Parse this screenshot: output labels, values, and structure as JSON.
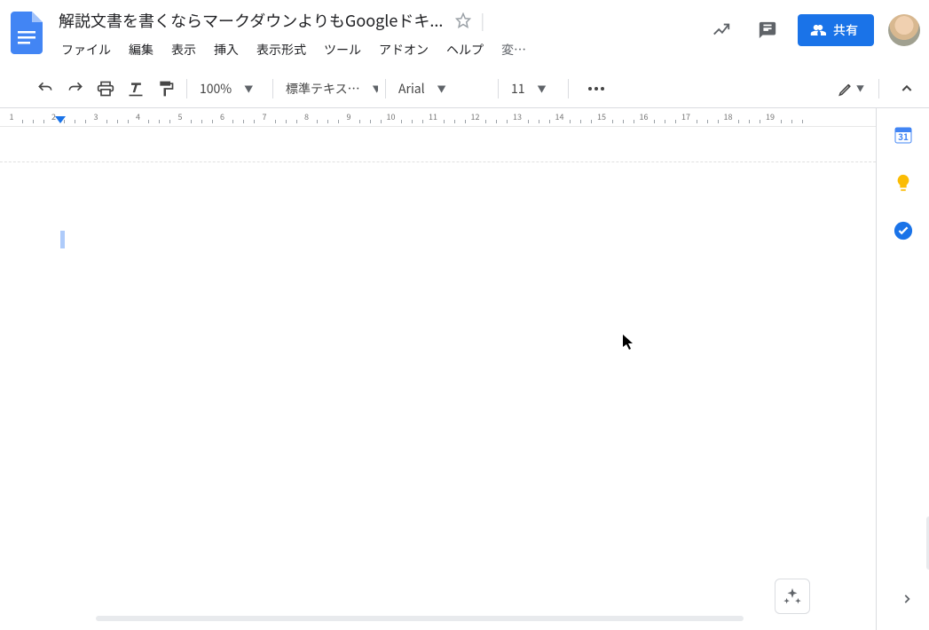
{
  "header": {
    "title": "解説文書を書くならマークダウンよりもGoogleドキ...",
    "menus": [
      "ファイル",
      "編集",
      "表示",
      "挿入",
      "表示形式",
      "ツール",
      "アドオン",
      "ヘルプ"
    ],
    "last_edit": "変…",
    "share_label": "共有"
  },
  "toolbar": {
    "zoom": "100%",
    "style": "標準テキス…",
    "font": "Arial",
    "font_size": "11"
  },
  "ruler": {
    "start": 1,
    "end": 19
  },
  "side_panel": {
    "calendar_day": "31"
  }
}
